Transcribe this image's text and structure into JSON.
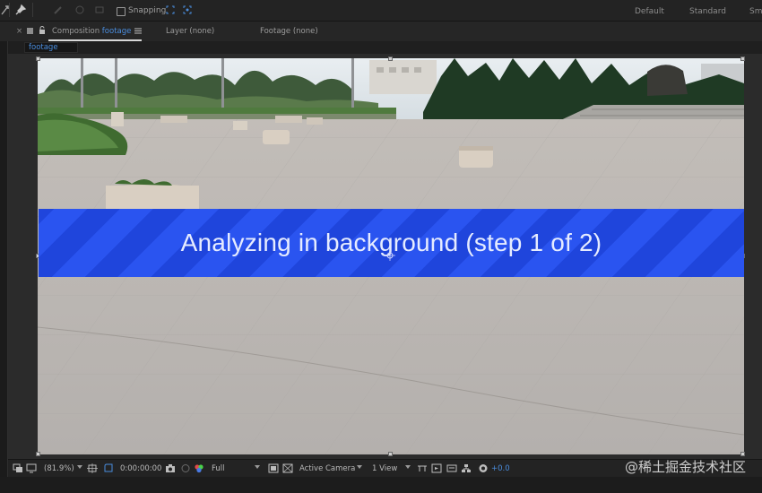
{
  "toolbar": {
    "snapping_label": "Snapping",
    "workspaces": [
      "Default",
      "Standard",
      "Sm"
    ]
  },
  "tabs": {
    "composition_prefix": "Composition",
    "composition_name": "footage",
    "layer": "Layer (none)",
    "footage": "Footage (none)"
  },
  "comp_name": "footage",
  "viewer": {
    "banner_text": "Analyzing in background (step 1 of 2)"
  },
  "bottom": {
    "zoom": "(81.9%)",
    "timecode": "0:00:00:00",
    "resolution": "Full",
    "camera": "Active Camera",
    "views": "1 View",
    "exposure": "+0.0"
  },
  "watermark": "@稀土掘金技术社区",
  "colors": {
    "accent_blue": "#4a8dde",
    "banner_blue": "#2a54f0"
  }
}
